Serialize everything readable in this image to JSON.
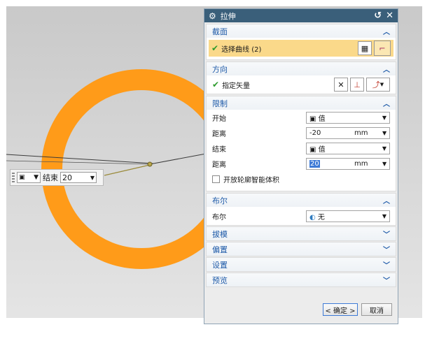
{
  "dialog": {
    "title": "拉伸",
    "sections": {
      "section": {
        "header": "截面",
        "select_curve": "选择曲线 (2)"
      },
      "direction": {
        "header": "方向",
        "specify_vector": "指定矢量"
      },
      "limits": {
        "header": "限制",
        "start_label": "开始",
        "start_value": "值",
        "distance1_label": "距离",
        "distance1_value": "-20",
        "distance1_unit": "mm",
        "end_label": "结束",
        "end_value": "值",
        "distance2_label": "距离",
        "distance2_value": "20",
        "distance2_unit": "mm",
        "open_profile": "开放轮廓智能体积"
      },
      "boolean": {
        "header": "布尔",
        "boolean_label": "布尔",
        "boolean_value": "无"
      },
      "draft": {
        "header": "拔模"
      },
      "offset": {
        "header": "偏置"
      },
      "settings": {
        "header": "设置"
      },
      "preview": {
        "header": "预览"
      }
    },
    "buttons": {
      "ok": "< 确定 >",
      "cancel": "取消"
    }
  },
  "float_bar": {
    "end_label": "结束",
    "end_value": "20"
  },
  "colors": {
    "ring": "#ff9b19",
    "titlebar": "#3a5f7a",
    "section_header_text": "#1e5aa8",
    "selection_highlight": "#fad98a"
  }
}
